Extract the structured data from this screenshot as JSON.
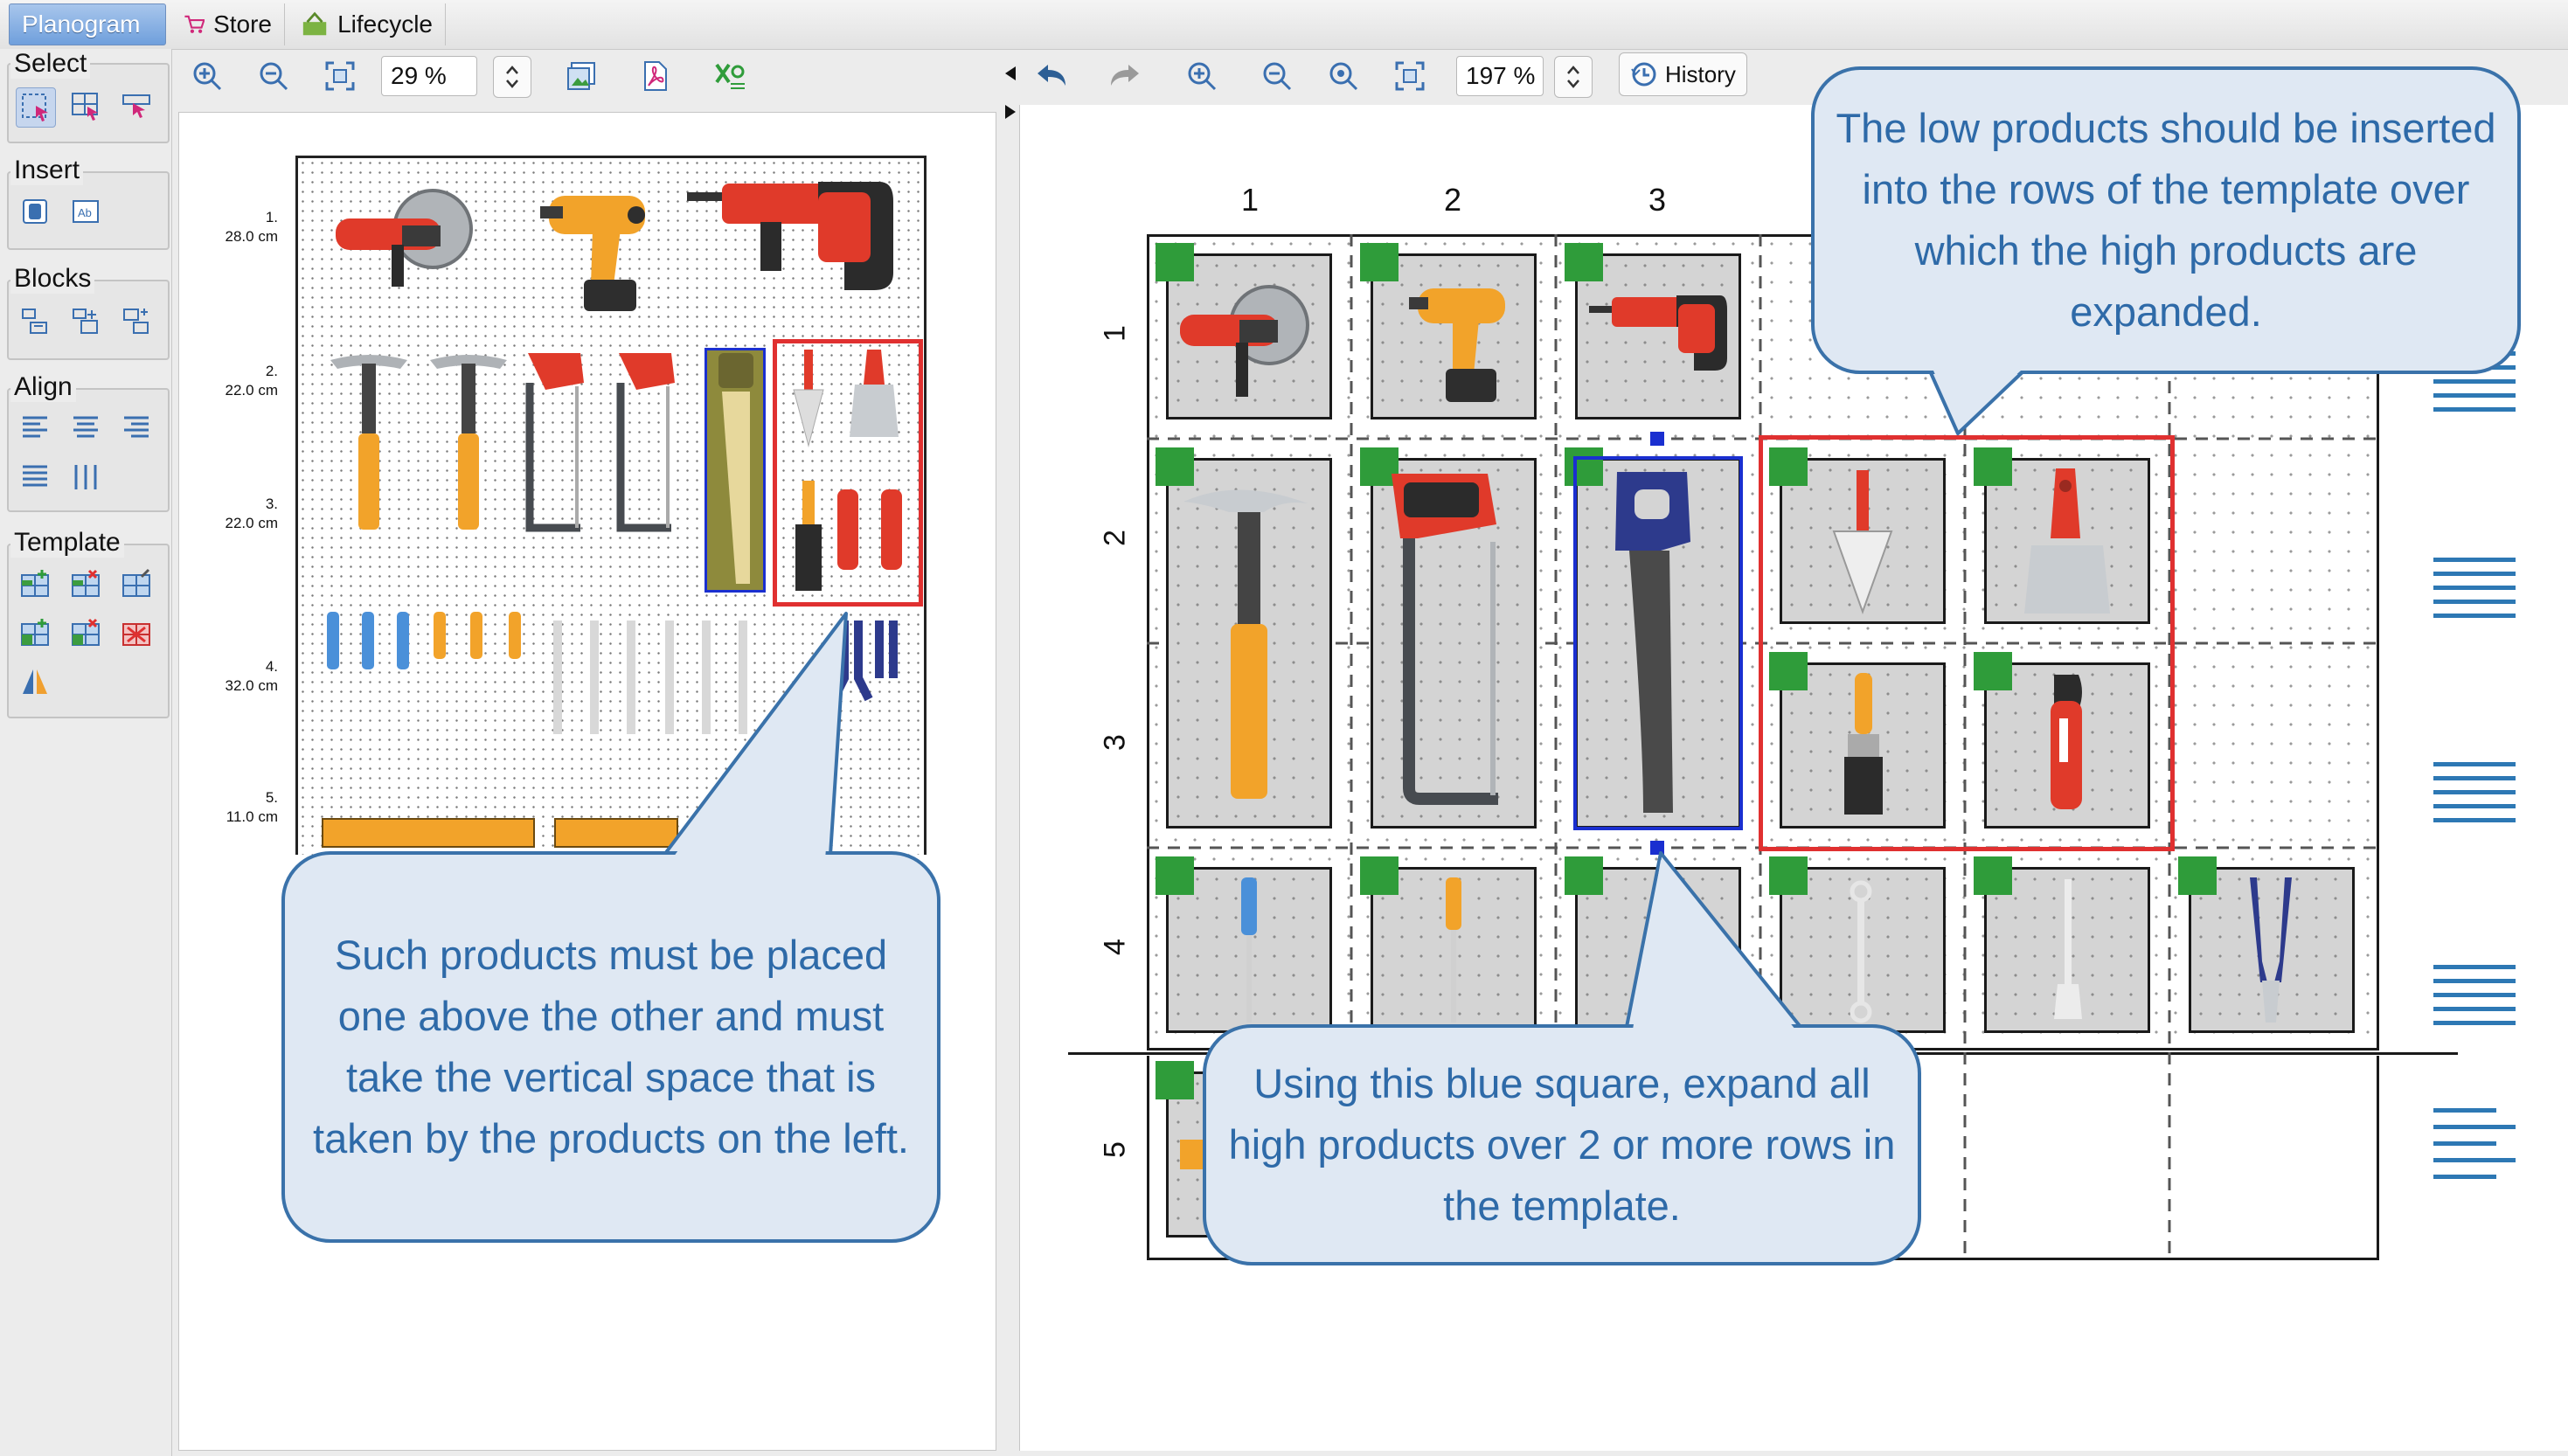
{
  "tabs": [
    {
      "label": "Planogram",
      "active": true
    },
    {
      "label": "Store",
      "icon": "cart-icon"
    },
    {
      "label": "Lifecycle",
      "icon": "lifecycle-icon"
    }
  ],
  "palette": {
    "select": "Select",
    "insert": "Insert",
    "blocks": "Blocks",
    "align": "Align",
    "template": "Template"
  },
  "left_toolbar": {
    "zoom": "29 %"
  },
  "right_toolbar": {
    "zoom": "197 %",
    "history": "History"
  },
  "left_view": {
    "shelves": [
      {
        "num": "1.",
        "height": "28.0 cm"
      },
      {
        "num": "2.",
        "height": "22.0 cm"
      },
      {
        "num": "3.",
        "height": "22.0 cm"
      },
      {
        "num": "4.",
        "height": "32.0 cm"
      },
      {
        "num": "5.",
        "height": "11.0 cm"
      }
    ]
  },
  "template_view": {
    "columns": [
      "1",
      "2",
      "3"
    ],
    "rows": [
      "1",
      "2",
      "3",
      "4",
      "5"
    ]
  },
  "callouts": {
    "top_right": "The low products should be inserted into the rows of the template over which the high products are expanded.",
    "left": "Such products must be placed one above the other and must take the vertical space that is taken by the products on the left.",
    "bottom": "Using this blue square, expand all high products over 2 or more rows in the template."
  },
  "colors": {
    "accent_blue": "#2e6aa8",
    "callout_bg": "#dfe8f3",
    "highlight_red": "#e03030",
    "selection_blue": "#1a2fd0",
    "template_marker_green": "#2f9c3a"
  }
}
